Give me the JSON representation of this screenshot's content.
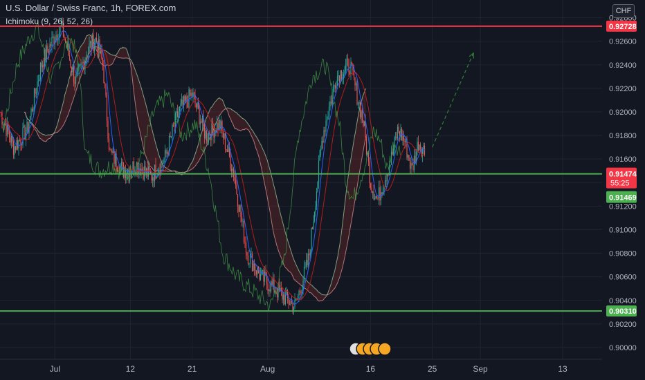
{
  "header": {
    "title": "U.S. Dollar / Swiss Franc, 1h, FOREX.com",
    "indicator": "Ichimoku (9, 26, 52, 26)"
  },
  "currency": "CHF",
  "colors": {
    "background": "#131722",
    "grid": "#1f2432",
    "up": "#26a69a",
    "down": "#ef5350",
    "resistance": "#f23645",
    "support": "#4caf50",
    "conversion": "#2962ff",
    "base": "#b71c1c",
    "lagging": "#43a047",
    "lead1": "#a5d6a7",
    "lead2": "#ef9a9a",
    "projection": "#2e7d32"
  },
  "chart_data": {
    "type": "candlestick",
    "title": "U.S. Dollar / Swiss Franc, 1h, FOREX.com",
    "indicator": "Ichimoku (9, 26, 52, 26)",
    "ylim": [
      0.899,
      0.9295
    ],
    "y_ticks": [
      "0.90000",
      "0.90200",
      "0.90400",
      "0.90600",
      "0.90800",
      "0.91000",
      "0.91200",
      "0.91400",
      "0.91600",
      "0.91800",
      "0.92000",
      "0.92200",
      "0.92400",
      "0.92600",
      "0.92800"
    ],
    "x_ticks": [
      "Jul",
      "12",
      "21",
      "Aug",
      "16",
      "25",
      "Sep",
      "13"
    ],
    "price_path": [
      {
        "x": "Jun 23",
        "y": 0.92
      },
      {
        "x": "Jun 25",
        "y": 0.917
      },
      {
        "x": "Jun 27",
        "y": 0.9185
      },
      {
        "x": "Jun 29",
        "y": 0.924
      },
      {
        "x": "Jul 1",
        "y": 0.9265
      },
      {
        "x": "Jul 2",
        "y": 0.9272
      },
      {
        "x": "Jul 4",
        "y": 0.9225
      },
      {
        "x": "Jul 6",
        "y": 0.9255
      },
      {
        "x": "Jul 7",
        "y": 0.9262
      },
      {
        "x": "Jul 8",
        "y": 0.924
      },
      {
        "x": "Jul 9",
        "y": 0.9165
      },
      {
        "x": "Jul 11",
        "y": 0.915
      },
      {
        "x": "Jul 13",
        "y": 0.9155
      },
      {
        "x": "Jul 15",
        "y": 0.9145
      },
      {
        "x": "Jul 17",
        "y": 0.916
      },
      {
        "x": "Jul 19",
        "y": 0.92
      },
      {
        "x": "Jul 21",
        "y": 0.9215
      },
      {
        "x": "Jul 23",
        "y": 0.918
      },
      {
        "x": "Jul 25",
        "y": 0.919
      },
      {
        "x": "Jul 27",
        "y": 0.915
      },
      {
        "x": "Jul 29",
        "y": 0.908
      },
      {
        "x": "Jul 31",
        "y": 0.906
      },
      {
        "x": "Aug 2",
        "y": 0.905
      },
      {
        "x": "Aug 4",
        "y": 0.904
      },
      {
        "x": "Aug 5",
        "y": 0.9035
      },
      {
        "x": "Aug 7",
        "y": 0.9075
      },
      {
        "x": "Aug 9",
        "y": 0.918
      },
      {
        "x": "Aug 11",
        "y": 0.923
      },
      {
        "x": "Aug 13",
        "y": 0.924
      },
      {
        "x": "Aug 15",
        "y": 0.919
      },
      {
        "x": "Aug 16",
        "y": 0.914
      },
      {
        "x": "Aug 17",
        "y": 0.9125
      },
      {
        "x": "Aug 19",
        "y": 0.916
      },
      {
        "x": "Aug 20",
        "y": 0.9185
      },
      {
        "x": "Aug 21",
        "y": 0.9175
      },
      {
        "x": "Aug 22",
        "y": 0.915
      },
      {
        "x": "Aug 23",
        "y": 0.9175
      },
      {
        "x": "Aug 24",
        "y": 0.9165
      }
    ],
    "horizontal_levels": [
      {
        "label": "0.92728",
        "value": 0.92728,
        "color": "#f23645"
      },
      {
        "label": "0.91474",
        "value": 0.91474,
        "color": "#4caf50"
      },
      {
        "label": "0.90310",
        "value": 0.9031,
        "color": "#4caf50"
      }
    ],
    "price_labels": [
      {
        "label": "0.91474",
        "value": 0.91474,
        "color": "#f23645",
        "countdown": "55:25"
      },
      {
        "label": "0.91469",
        "value": 0.91469,
        "color": "#4caf50"
      }
    ],
    "projection": {
      "from": {
        "x": "Aug 25",
        "y": 0.917
      },
      "to": {
        "x": "Aug 31",
        "y": 0.925
      },
      "style": "dashed-arrow"
    }
  }
}
